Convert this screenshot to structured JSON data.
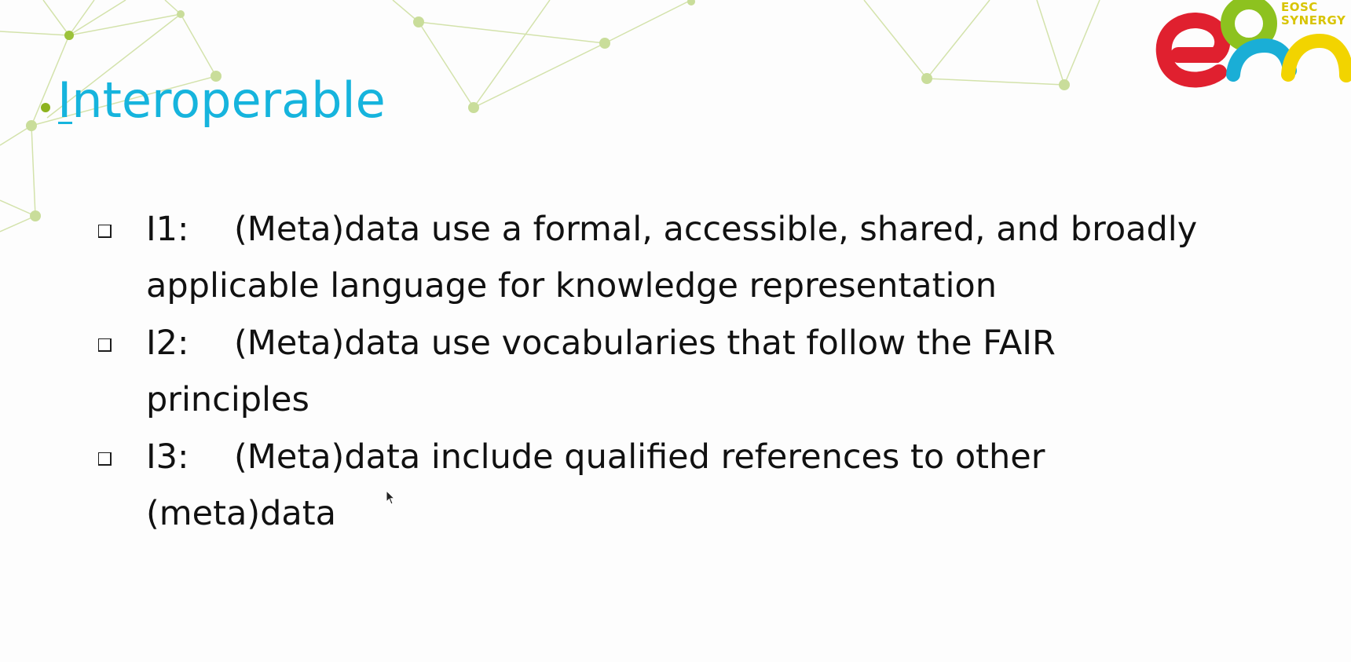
{
  "slide": {
    "title": "Interoperable",
    "logo": {
      "name": "eosc-synergy-logo",
      "text_line1": "EOSC",
      "text_line2": "SYNERGY"
    },
    "items": [
      {
        "code": "I1:",
        "line1": "(Meta)data use a formal, accessible, shared, and broadly",
        "line2": "applicable language for knowledge representation"
      },
      {
        "code": "I2:",
        "line1": "(Meta)data use vocabularies that follow the FAIR",
        "line2": "principles"
      },
      {
        "code": "I3:",
        "line1": "(Meta)data include qualified references to other",
        "line2": "(meta)data"
      }
    ]
  },
  "colors": {
    "title": "#16b4dd",
    "text": "#111111",
    "network": "#c9dd9a",
    "logo_red": "#e0202f",
    "logo_green": "#8dc21f",
    "logo_blue": "#1aaed6",
    "logo_yellow": "#f2d400"
  },
  "icons": [
    "checkbox-icon",
    "mouse-cursor-icon",
    "title-bullet-icon"
  ]
}
